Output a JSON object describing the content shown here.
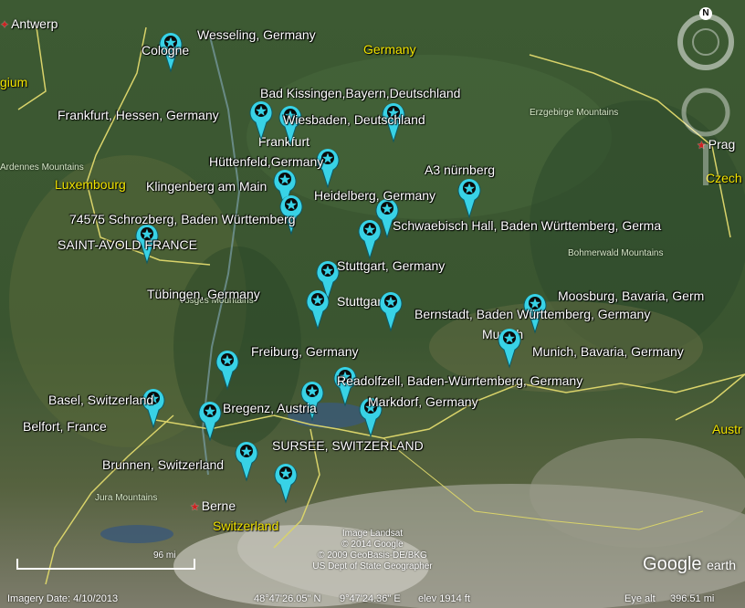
{
  "map": {
    "countries": {
      "germany": "Germany",
      "luxembourg": "Luxembourg",
      "switzerland": "Switzerland",
      "belgium_partial": "gium",
      "czech_partial": "Czech",
      "austria_partial": "Austr"
    },
    "regions": {
      "erzgebirge": "Erzgebirge Mountains",
      "ardennes": "Ardennes Mountains",
      "bohmerwald": "Bohmerwald Mountains",
      "jura": "Jura Mountains",
      "vosges": "Vosges Mountains"
    },
    "cities": {
      "antwerp": "Antwerp",
      "prague": "Prag",
      "berne": "Berne",
      "munich": "Munich",
      "stuttgart": "Stuttgart",
      "frankfurt": "Frankfurt",
      "cologne": "Cologne",
      "wesseling": "Wesseling, Germany",
      "bad_kissingen": "Bad Kissingen,Bayern,Deutschland",
      "frankfurt_hessen": "Frankfurt, Hessen, Germany",
      "wiesbaden": "Wiesbaden, Deutschland",
      "huttenfeld": "Hüttenfeld,Germany",
      "a3_nurnberg": "A3 nürnberg",
      "klingenberg": "Klingenberg am Main",
      "heidelberg": "Heidelberg, Germany",
      "schrozberg": "74575 Schrozberg, Baden Württemberg",
      "schwaebisch_hall": "Schwaebisch Hall, Baden Württemberg, Germa",
      "saint_avold": "SAINT-AVOLD FRANCE",
      "stuttgart_germany": "Stuttgart, Germany",
      "moosburg": "Moosburg, Bavaria, Germ",
      "tubingen": "Tübingen, Germany",
      "bernstadt": "Bernstadt, Baden Württemberg, Germany",
      "munich_bavaria": "Munich, Bavaria, Germany",
      "freiburg": "Freiburg, Germany",
      "readolfzell": "Readolfzell, Baden-Würrtemberg, Germany",
      "basel": "Basel, Switzerland",
      "markdorf": "Markdorf, Germany",
      "bregenz": "Bregenz, Austria",
      "belfort": "Belfort, France",
      "sursee": "SURSEE, SWITZERLAND",
      "brunnen": "Brunnen, Switzerland"
    },
    "scale": "96 mi",
    "credits": [
      "Image Landsat",
      "© 2014 Google",
      "© 2009 GeoBasis-DE/BKG",
      "US Dept of State Geographer"
    ]
  },
  "logo": {
    "brand": "Google",
    "product": "earth"
  },
  "compass": {
    "north": "N"
  },
  "status": {
    "imagery_date": "Imagery Date: 4/10/2013",
    "lat": "48°47'26.05\" N",
    "lon": "9°47'24.36\" E",
    "elev": "elev  1914 ft",
    "eye_alt_label": "Eye alt",
    "eye_alt_value": "396.51 mi"
  },
  "colors": {
    "pin": "#38d2e6",
    "country_label": "#f2e500",
    "border": "#d9d36a"
  }
}
